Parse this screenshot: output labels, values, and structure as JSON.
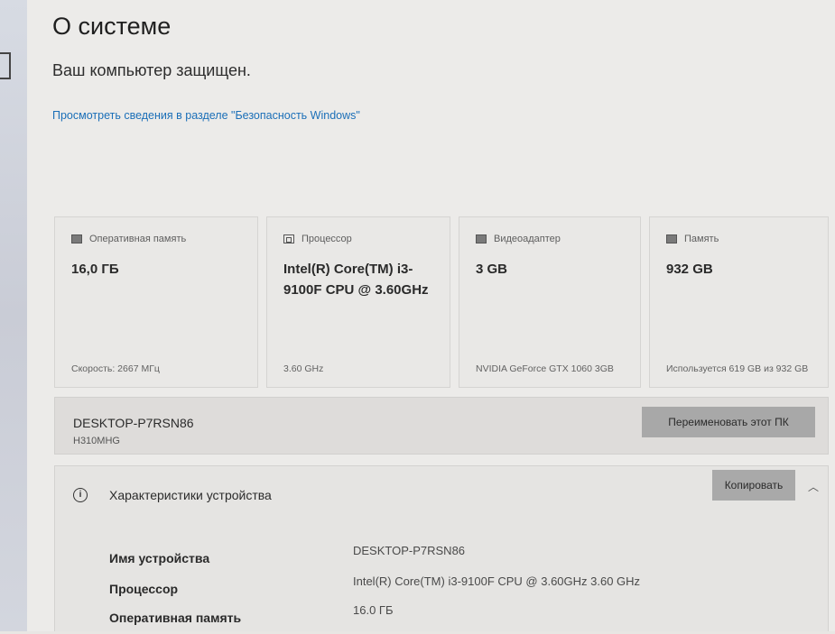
{
  "page": {
    "title": "О системе",
    "protection_status": "Ваш компьютер защищен.",
    "security_link": "Просмотреть сведения в разделе \"Безопасность Windows\""
  },
  "cards": [
    {
      "icon": "ram-icon",
      "label": "Оперативная память",
      "value": "16,0 ГБ",
      "sub": "Скорость: 2667 МГц"
    },
    {
      "icon": "cpu-icon",
      "label": "Процессор",
      "value": "Intel(R) Core(TM) i3-9100F CPU @ 3.60GHz",
      "sub": "3.60 GHz"
    },
    {
      "icon": "gpu-icon",
      "label": "Видеоадаптер",
      "value": "3 GB",
      "sub": "NVIDIA GeForce GTX 1060 3GB"
    },
    {
      "icon": "storage-icon",
      "label": "Память",
      "value": "932 GB",
      "sub": "Используется 619 GB из 932 GB"
    }
  ],
  "device": {
    "name": "DESKTOP-P7RSN86",
    "model": "H310MHG",
    "rename_label": "Переименовать этот ПК"
  },
  "specs": {
    "title": "Характеристики устройства",
    "copy_label": "Копировать",
    "rows": [
      {
        "label": "Имя устройства",
        "value": "DESKTOP-P7RSN86"
      },
      {
        "label": "Процессор",
        "value": "Intel(R) Core(TM) i3-9100F CPU @ 3.60GHz   3.60 GHz"
      },
      {
        "label": "Оперативная память",
        "value": "16.0 ГБ"
      }
    ]
  }
}
